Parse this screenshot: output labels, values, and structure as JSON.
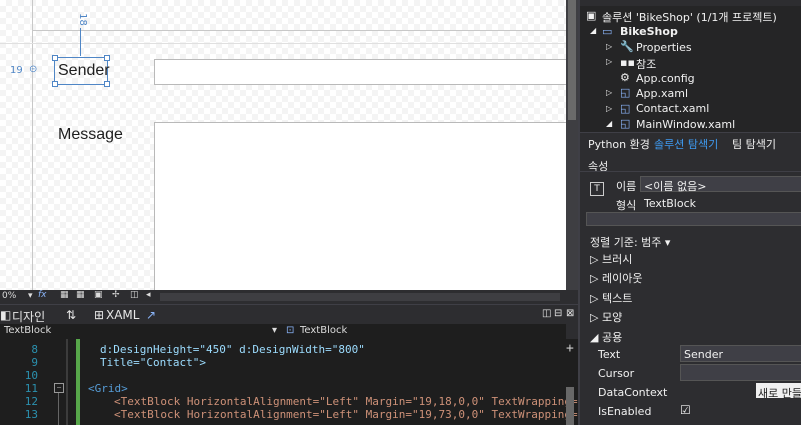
{
  "designer": {
    "ruler_top": "18",
    "ruler_left": "19",
    "sender_label": "Sender",
    "message_label": "Message"
  },
  "designer_toolbar": {
    "zoom": "0%",
    "fx": "fx"
  },
  "tabs": {
    "design": "디자인",
    "swap": "⇅",
    "xaml": "XAML",
    "split_icon": "⊟"
  },
  "navbar": {
    "left": "TextBlock",
    "right": "TextBlock"
  },
  "editor": {
    "lines": [
      {
        "n": "8",
        "text": "d:DesignHeight=\"450\" d:DesignWidth=\"800\""
      },
      {
        "n": "9",
        "text": "Title=\"Contact\">"
      },
      {
        "n": "10",
        "text": ""
      },
      {
        "n": "11",
        "text": "<Grid>"
      },
      {
        "n": "12",
        "text": "<TextBlock HorizontalAlignment=\"Left\" Margin=\"19,18,0,0\" TextWrapping=\"W"
      },
      {
        "n": "13",
        "text": "<TextBlock HorizontalAlignment=\"Left\" Margin=\"19,73,0,0\" TextWrapping=\"W"
      }
    ]
  },
  "solution": {
    "header": "솔루션 'BikeShop' (1/1개 프로젝트)",
    "project": "BikeShop",
    "items": [
      "Properties",
      "참조",
      "App.config",
      "App.xaml",
      "Contact.xaml",
      "MainWindow.xaml"
    ]
  },
  "panel_tabs": [
    "Python 환경",
    "솔루션 탐색기",
    "팀 탐색기"
  ],
  "properties": {
    "title": "속성",
    "name_label": "이름",
    "name_value": "<이름 없음>",
    "type_label": "형식",
    "type_value": "TextBlock",
    "sort_label": "정렬 기준: 범주 ▾",
    "categories": [
      "브러시",
      "레이아웃",
      "텍스트",
      "모양"
    ],
    "common": "공용",
    "rows": [
      {
        "label": "Text",
        "value": "Sender"
      },
      {
        "label": "Cursor",
        "value": ""
      },
      {
        "label": "DataContext",
        "value": "새로 만들"
      },
      {
        "label": "IsEnabled",
        "value": "☑"
      }
    ]
  }
}
